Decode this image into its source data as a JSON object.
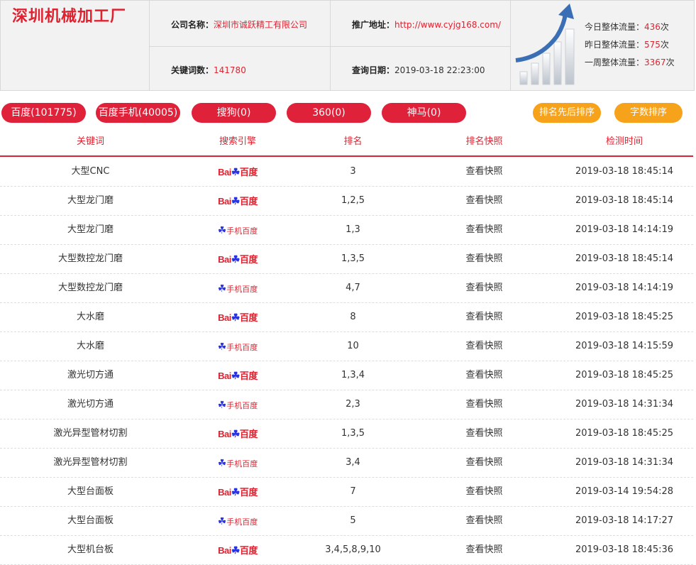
{
  "header": {
    "site_title": "深圳机械加工厂",
    "company_label": "公司名称：",
    "company_value": "深圳市诚跃精工有限公司",
    "url_label": "推广地址：",
    "url_value": "http://www.cyjg168.com/",
    "keywords_label": "关键词数：",
    "keywords_value": "141780",
    "date_label": "查询日期：",
    "date_value": "2019-03-18 22:23:00",
    "stats": {
      "today_label": "今日整体流量：",
      "today_value": "436",
      "today_unit": "次",
      "yesterday_label": "昨日整体流量：",
      "yesterday_value": "575",
      "yesterday_unit": "次",
      "week_label": "一周整体流量：",
      "week_value": "3367",
      "week_unit": "次"
    }
  },
  "tabs": [
    "百度(101775)",
    "百度手机(40005)",
    "搜狗(0)",
    "360(0)",
    "神马(0)"
  ],
  "sort_buttons": [
    "排名先后排序",
    "字数排序"
  ],
  "table": {
    "columns": [
      "关键词",
      "搜索引擎",
      "排名",
      "排名快照",
      "检测时间"
    ],
    "rows": [
      {
        "keyword": "大型CNC",
        "engine": "baidu",
        "rank": "3",
        "snapshot": "查看快照",
        "time": "2019-03-18 18:45:14"
      },
      {
        "keyword": "大型龙门磨",
        "engine": "baidu",
        "rank": "1,2,5",
        "snapshot": "查看快照",
        "time": "2019-03-18 18:45:14"
      },
      {
        "keyword": "大型龙门磨",
        "engine": "mobile",
        "rank": "1,3",
        "snapshot": "查看快照",
        "time": "2019-03-18 14:14:19"
      },
      {
        "keyword": "大型数控龙门磨",
        "engine": "baidu",
        "rank": "1,3,5",
        "snapshot": "查看快照",
        "time": "2019-03-18 18:45:14"
      },
      {
        "keyword": "大型数控龙门磨",
        "engine": "mobile",
        "rank": "4,7",
        "snapshot": "查看快照",
        "time": "2019-03-18 14:14:19"
      },
      {
        "keyword": "大水磨",
        "engine": "baidu",
        "rank": "8",
        "snapshot": "查看快照",
        "time": "2019-03-18 18:45:25"
      },
      {
        "keyword": "大水磨",
        "engine": "mobile",
        "rank": "10",
        "snapshot": "查看快照",
        "time": "2019-03-18 14:15:59"
      },
      {
        "keyword": "激光切方通",
        "engine": "baidu",
        "rank": "1,3,4",
        "snapshot": "查看快照",
        "time": "2019-03-18 18:45:25"
      },
      {
        "keyword": "激光切方通",
        "engine": "mobile",
        "rank": "2,3",
        "snapshot": "查看快照",
        "time": "2019-03-18 14:31:34"
      },
      {
        "keyword": "激光异型管材切割",
        "engine": "baidu",
        "rank": "1,3,5",
        "snapshot": "查看快照",
        "time": "2019-03-18 18:45:25"
      },
      {
        "keyword": "激光异型管材切割",
        "engine": "mobile",
        "rank": "3,4",
        "snapshot": "查看快照",
        "time": "2019-03-18 14:31:34"
      },
      {
        "keyword": "大型台面板",
        "engine": "baidu",
        "rank": "7",
        "snapshot": "查看快照",
        "time": "2019-03-14 19:54:28"
      },
      {
        "keyword": "大型台面板",
        "engine": "mobile",
        "rank": "5",
        "snapshot": "查看快照",
        "time": "2019-03-18 14:17:27"
      },
      {
        "keyword": "大型机台板",
        "engine": "baidu",
        "rank": "3,4,5,8,9,10",
        "snapshot": "查看快照",
        "time": "2019-03-18 18:45:36"
      }
    ]
  },
  "logos": {
    "baidu_text_a": "Bai",
    "baidu_paw": "☘",
    "baidu_text_b": "百度",
    "mobile_text": "手机百度"
  },
  "colors": {
    "accent_red": "#e0213a",
    "accent_orange": "#f7a21b",
    "link_red": "#e0212f"
  }
}
